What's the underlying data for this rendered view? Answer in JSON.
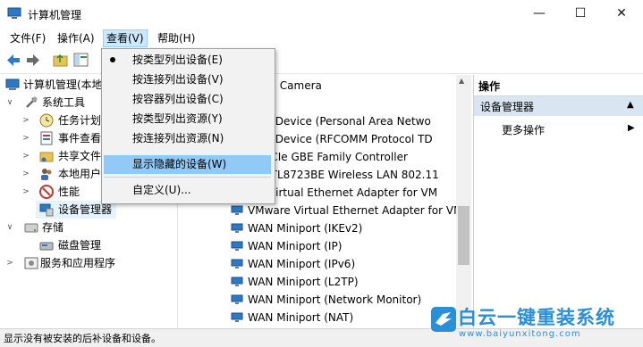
{
  "window": {
    "title": "计算机管理"
  },
  "window_controls": {
    "minimize": "—",
    "maximize": "☐",
    "close": "✕"
  },
  "menubar": {
    "file": "文件(F)",
    "action": "操作(A)",
    "view": "查看(V)",
    "help": "帮助(H)"
  },
  "tree": {
    "root": "计算机管理(本地",
    "system_tools": "系统工具",
    "task_scheduler": "任务计划",
    "event_viewer": "事件查看",
    "shared_folders": "共享文件",
    "local_users": "本地用户",
    "performance": "性能",
    "device_manager": "设备管理器",
    "storage": "存储",
    "disk_management": "磁盘管理",
    "services": "服务和应用程序"
  },
  "devices": [
    "rated Camera",
    "器",
    "ooth Device (Personal Area Netwo",
    "ooth Device (RFCOMM Protocol TD",
    "ek PCIe GBE Family Controller",
    "ek RTL8723BE Wireless LAN 802.11",
    "are Virtual Ethernet Adapter for VM",
    "VMware Virtual Ethernet Adapter for VM",
    "WAN Miniport (IKEv2)",
    "WAN Miniport (IP)",
    "WAN Miniport (IPv6)",
    "WAN Miniport (L2TP)",
    "WAN Miniport (Network Monitor)",
    "WAN Miniport (NAT)"
  ],
  "actions": {
    "header": "操作",
    "section": "设备管理器",
    "more": "更多操作",
    "section_arrow": "▲",
    "more_arrow": "▶"
  },
  "view_menu": {
    "by_type": "按类型列出设备(E)",
    "by_connection": "按连接列出设备(V)",
    "by_container": "按容器列出设备(C)",
    "resources_by_type": "按类型列出资源(Y)",
    "resources_by_connection": "按连接列出资源(N)",
    "show_hidden": "显示隐藏的设备(W)",
    "customize": "自定义(U)..."
  },
  "status": {
    "text": "显示没有被安装的后补设备和设备。"
  },
  "watermark": {
    "name": "白云一键重装系统",
    "url": "www.baiyunxitong.com"
  },
  "colors": {
    "accent": "#2a8fd6",
    "menu_highlight": "#91c9f7",
    "selection": "#e5f3ff",
    "actions_section": "#d9e6f2"
  }
}
